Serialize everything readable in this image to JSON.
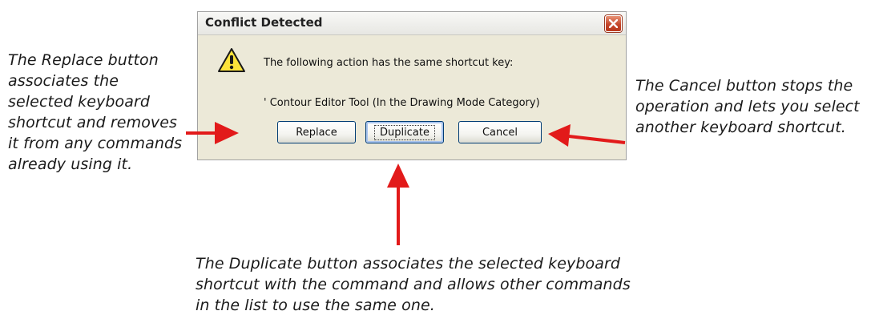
{
  "dialog": {
    "title": "Conflict Detected",
    "message": "The following action has the same shortcut key:",
    "conflict_item": "' Contour Editor Tool (In the Drawing Mode Category)",
    "buttons": {
      "replace": "Replace",
      "duplicate": "Duplicate",
      "cancel": "Cancel"
    },
    "icons": {
      "warning": "warning-icon",
      "close": "close-icon"
    }
  },
  "annotations": {
    "replace": "The Replace button associates the selected keyboard shortcut and removes it from any commands already using it.",
    "cancel": "The Cancel button stops the operation and lets you select another keyboard shortcut.",
    "duplicate": "The Duplicate button associates the selected keyboard shortcut with the command and allows other commands in the list to use the same one."
  },
  "colors": {
    "arrow": "#e21a1a",
    "dialog_bg": "#ece9d8",
    "close_button": "#c4472c",
    "button_border": "#003c74"
  }
}
